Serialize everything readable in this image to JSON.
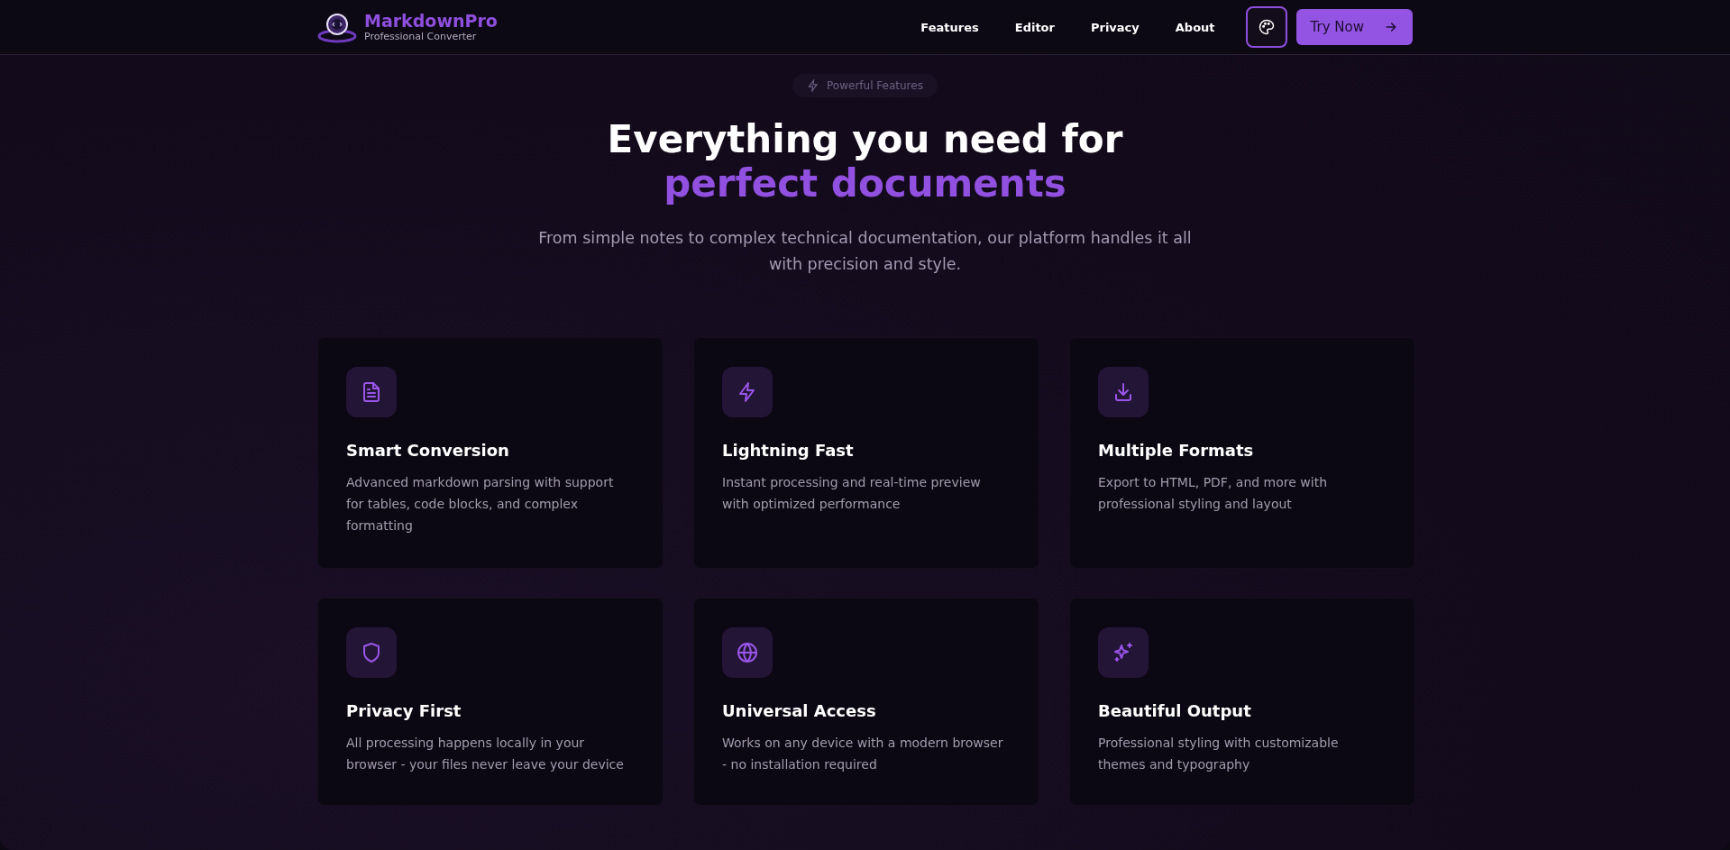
{
  "header": {
    "brand": "MarkdownPro",
    "tagline": "Professional Converter",
    "nav": [
      {
        "label": "Features"
      },
      {
        "label": "Editor"
      },
      {
        "label": "Privacy"
      },
      {
        "label": "About"
      }
    ],
    "cta": "Try Now"
  },
  "hero": {
    "badge": "Powerful Features",
    "title_line1": "Everything you need for",
    "title_line2": "perfect documents",
    "subtitle": "From simple notes to complex technical documentation, our platform handles it all with precision and style."
  },
  "features": [
    {
      "title": "Smart Conversion",
      "description": "Advanced markdown parsing with support for tables, code blocks, and complex formatting"
    },
    {
      "title": "Lightning Fast",
      "description": "Instant processing and real-time preview with optimized performance"
    },
    {
      "title": "Multiple Formats",
      "description": "Export to HTML, PDF, and more with professional styling and layout"
    },
    {
      "title": "Privacy First",
      "description": "All processing happens locally in your browser - your files never leave your device"
    },
    {
      "title": "Universal Access",
      "description": "Works on any device with a modern browser - no installation required"
    },
    {
      "title": "Beautiful Output",
      "description": "Professional styling with customizable themes and typography"
    }
  ]
}
